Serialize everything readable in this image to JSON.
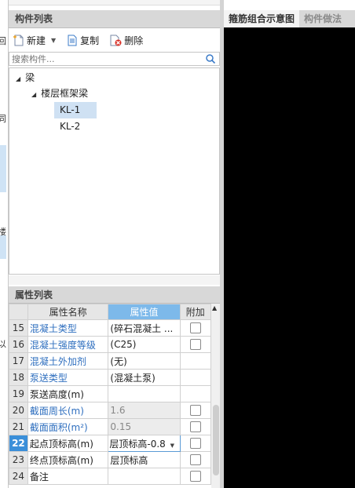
{
  "left_strip": {
    "fragments": [
      "回",
      "同",
      "以",
      "楼"
    ]
  },
  "component_panel": {
    "title": "构件列表",
    "toolbar": {
      "new_label": "新建",
      "copy_label": "复制",
      "delete_label": "删除"
    },
    "search": {
      "placeholder": "搜索构件..."
    },
    "tree": {
      "root": "梁",
      "group": "楼层框架梁",
      "items": [
        "KL-1",
        "KL-2"
      ],
      "selected": "KL-1"
    }
  },
  "property_panel": {
    "title": "属性列表",
    "columns": {
      "name": "属性名称",
      "value": "属性值",
      "extra": "附加"
    },
    "rows": [
      {
        "num": "15",
        "name": "混凝土类型",
        "value": "(碎石混凝土 ...",
        "checkbox": true
      },
      {
        "num": "16",
        "name": "混凝土强度等级",
        "value": "(C25)",
        "checkbox": true
      },
      {
        "num": "17",
        "name": "混凝土外加剂",
        "value": "(无)",
        "checkbox": false
      },
      {
        "num": "18",
        "name": "泵送类型",
        "value": "(混凝土泵)",
        "checkbox": false
      },
      {
        "num": "19",
        "name": "泵送高度(m)",
        "value": "",
        "checkbox": false
      },
      {
        "num": "20",
        "name": "截面周长(m)",
        "value": "1.6",
        "checkbox": true
      },
      {
        "num": "21",
        "name": "截面面积(m²)",
        "value": "0.15",
        "checkbox": true
      },
      {
        "num": "22",
        "name": "起点顶标高(m)",
        "value": "层顶标高-0.8",
        "checkbox": true
      },
      {
        "num": "23",
        "name": "终点顶标高(m)",
        "value": "层顶标高",
        "checkbox": true
      },
      {
        "num": "24",
        "name": "备注",
        "value": "",
        "checkbox": true
      }
    ]
  },
  "right_panel": {
    "tabs": [
      "箍筋组合示意图",
      "构件做法"
    ]
  },
  "colors": {
    "accent_blue": "#3b8fd9",
    "header_blue": "#7db9ea",
    "link_blue": "#2f6fbf",
    "canvas": "#000000"
  }
}
